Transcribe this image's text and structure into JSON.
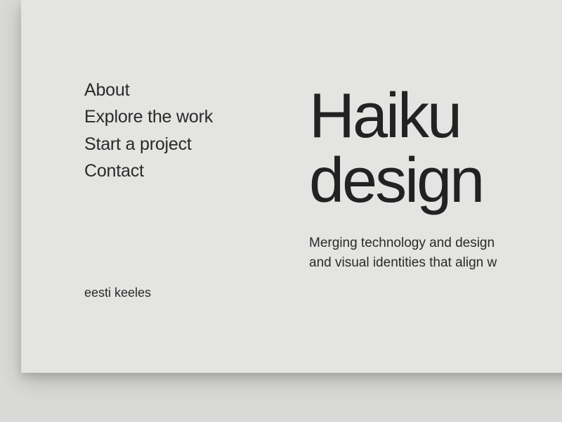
{
  "nav": {
    "items": [
      {
        "label": "About"
      },
      {
        "label": "Explore the work"
      },
      {
        "label": "Start a project"
      },
      {
        "label": "Contact"
      }
    ],
    "language": "eesti keeles"
  },
  "hero": {
    "title_line1": "Haiku",
    "title_line2": "design",
    "sub_line1": "Merging technology and design",
    "sub_line2": "and visual identities that align w"
  }
}
